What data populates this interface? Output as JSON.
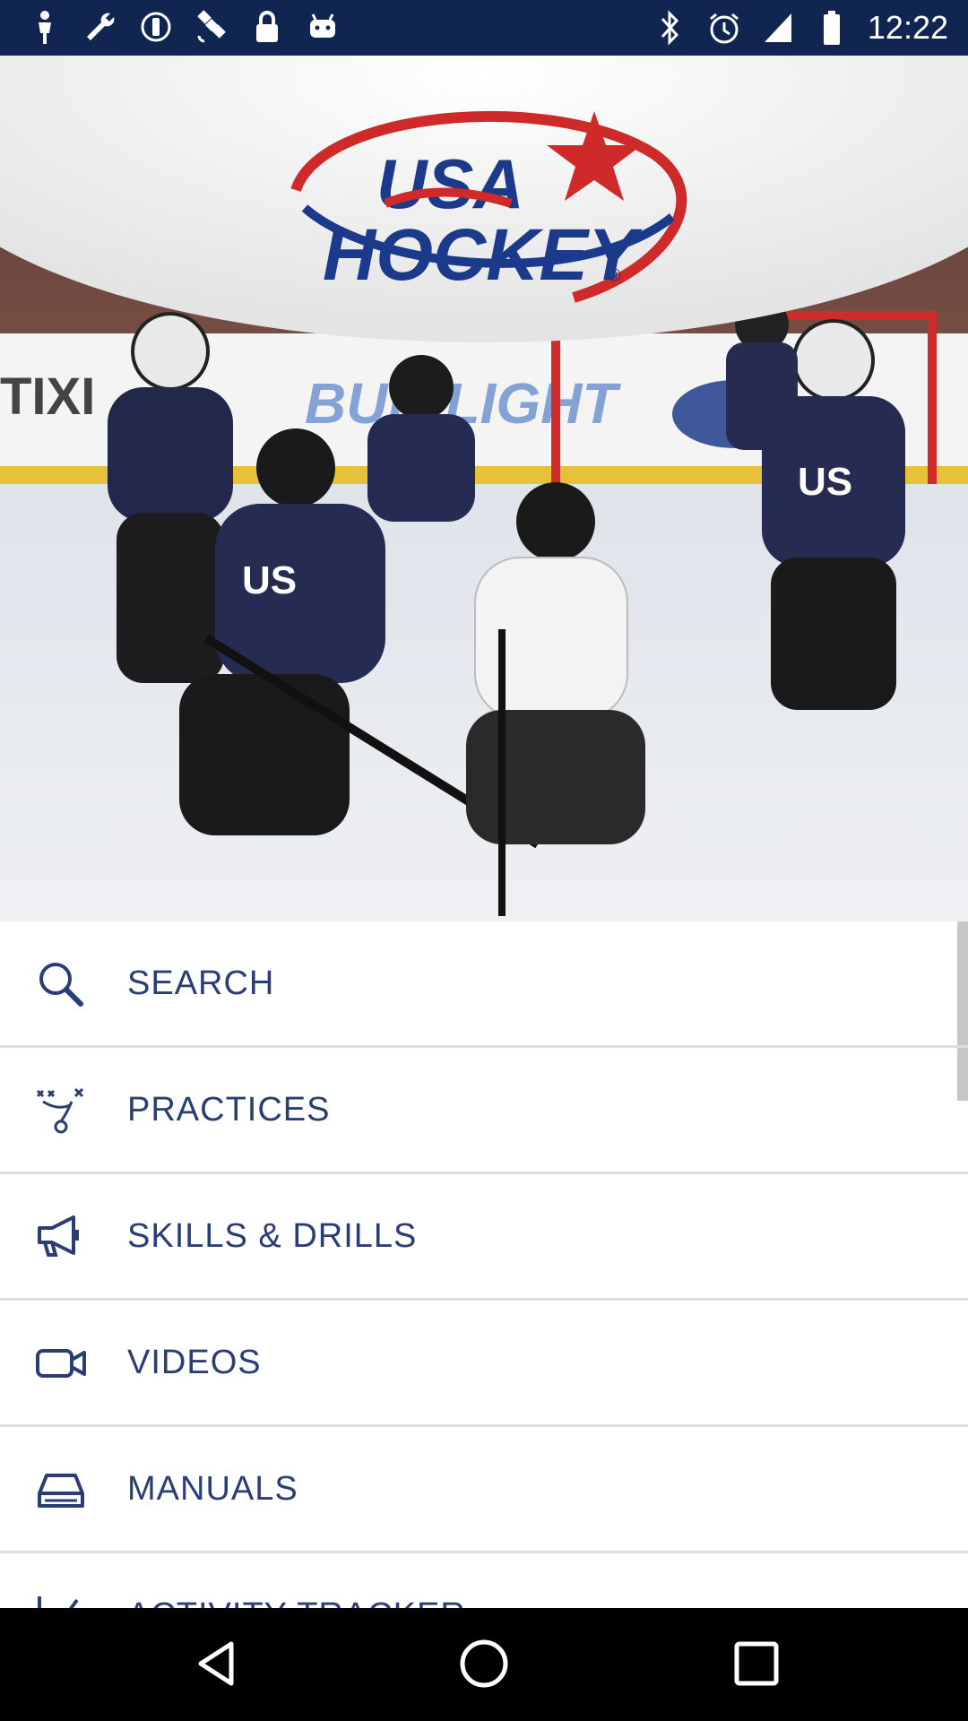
{
  "status_bar": {
    "time": "12:22",
    "left_icons": [
      "person-icon",
      "wrench-icon",
      "info-icon",
      "satellite-icon",
      "lock-icon",
      "android-icon"
    ],
    "right_icons": [
      "bluetooth-icon",
      "alarm-icon",
      "signal-icon",
      "battery-icon"
    ]
  },
  "hero": {
    "logo_line1": "USA",
    "logo_line2": "HOCKEY",
    "logo_mark": "®"
  },
  "menu": {
    "items": [
      {
        "label": "SEARCH",
        "icon": "search-icon"
      },
      {
        "label": "PRACTICES",
        "icon": "strategy-icon"
      },
      {
        "label": "SKILLS & DRILLS",
        "icon": "megaphone-icon"
      },
      {
        "label": "VIDEOS",
        "icon": "video-camera-icon"
      },
      {
        "label": "MANUALS",
        "icon": "manual-icon"
      },
      {
        "label": "ACTIVITY TRACKER",
        "icon": "activity-chart-icon"
      }
    ]
  },
  "navigation": {
    "buttons": [
      "back-icon",
      "home-icon",
      "recents-icon"
    ]
  },
  "colors": {
    "status_bar": "#10254f",
    "menu_text": "#2a3d74",
    "logo_navy": "#1b3a8c",
    "logo_red": "#cf2a2a"
  }
}
